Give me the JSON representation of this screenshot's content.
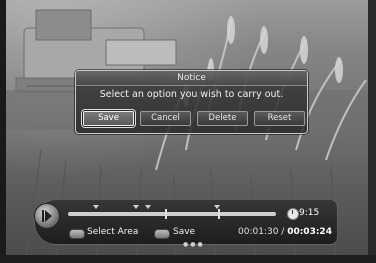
{
  "dialog": {
    "title": "Notice",
    "message": "Select an option you wish to carry out.",
    "buttons": [
      {
        "label": "Save",
        "selected": true
      },
      {
        "label": "Cancel",
        "selected": false
      },
      {
        "label": "Delete",
        "selected": false
      },
      {
        "label": "Reset",
        "selected": false
      }
    ]
  },
  "osd": {
    "clock": "9:15",
    "keys": [
      {
        "label": "Select Area"
      },
      {
        "label": "Save"
      }
    ],
    "elapsed": "00:01:30",
    "separator": " / ",
    "total": "00:03:24",
    "play_icon": "play-pause-icon",
    "clock_icon": "clock-icon"
  }
}
